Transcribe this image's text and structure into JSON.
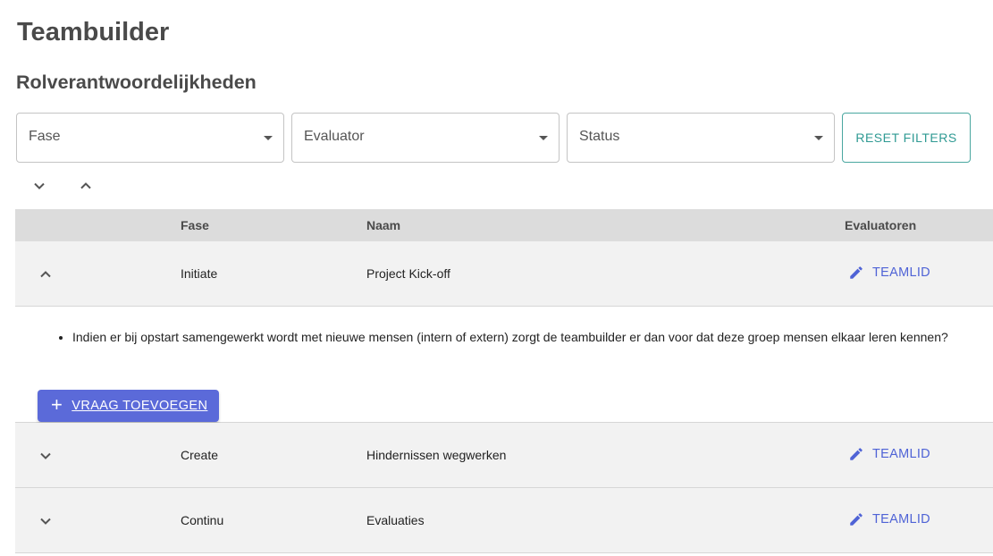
{
  "header": {
    "title": "Teambuilder",
    "subtitle": "Rolverantwoordelijkheden"
  },
  "filters": {
    "fase_label": "Fase",
    "evaluator_label": "Evaluator",
    "status_label": "Status",
    "reset_label": "RESET FILTERS"
  },
  "table": {
    "columns": {
      "fase": "Fase",
      "naam": "Naam",
      "evaluatoren": "Evaluatoren"
    },
    "rows": [
      {
        "fase": "Initiate",
        "naam": "Project Kick-off",
        "evaluator": "TEAMLID",
        "expanded": true
      },
      {
        "fase": "Create",
        "naam": "Hindernissen wegwerken",
        "evaluator": "TEAMLID",
        "expanded": false
      },
      {
        "fase": "Continu",
        "naam": "Evaluaties",
        "evaluator": "TEAMLID",
        "expanded": false
      }
    ],
    "detail": {
      "question": "Indien er bij opstart samengewerkt wordt met nieuwe mensen (intern of extern) zorgt de teambuilder er dan voor dat deze groep mensen elkaar leren kennen?",
      "add_button": "VRAAG TOEVOEGEN"
    }
  },
  "colors": {
    "accent_blue": "#5b6ad9",
    "teal": "#2f9a93",
    "header_bg": "#dcdcdc",
    "row_bg": "#f2f2f2"
  },
  "icons": {
    "expand_all": "chevron-down-icon",
    "collapse_all": "chevron-up-icon",
    "edit": "pencil-icon",
    "add": "plus-icon"
  }
}
